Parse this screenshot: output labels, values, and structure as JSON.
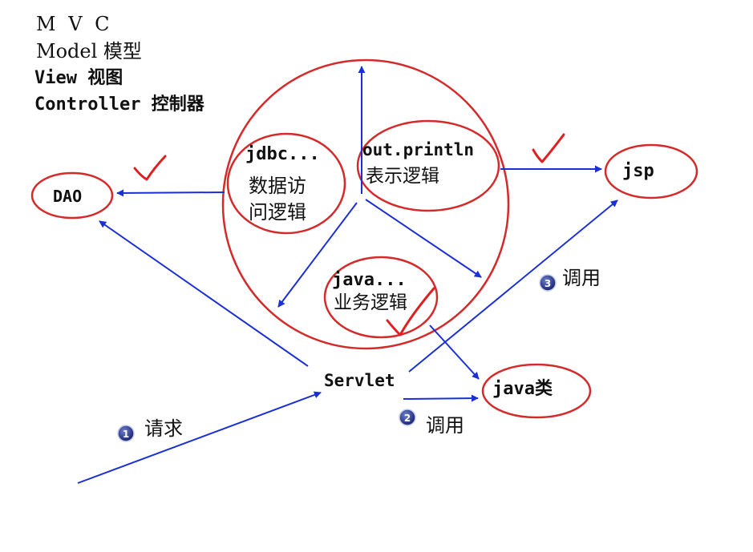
{
  "title_lines": {
    "mvc": "M V C",
    "model": "Model 模型",
    "view": "View 视图",
    "controller": "Controller 控制器"
  },
  "nodes": {
    "dao": "DAO",
    "jsp": "jsp",
    "java_class": "java类",
    "servlet": "Servlet",
    "jdbc_title": "jdbc...",
    "jdbc_line1": "数据访",
    "jdbc_line2": "问逻辑",
    "out_title": "out.println",
    "out_line1": "表示逻辑",
    "java_title": "java...",
    "java_line1": "业务逻辑"
  },
  "steps": [
    {
      "number": "1",
      "label": "请求"
    },
    {
      "number": "2",
      "label": "调用"
    },
    {
      "number": "3",
      "label": "调用"
    }
  ],
  "colors": {
    "ellipse": "#d42a2a",
    "arrow": "#1a2fd6",
    "check": "#e02020",
    "badge": "#1e2a78"
  }
}
